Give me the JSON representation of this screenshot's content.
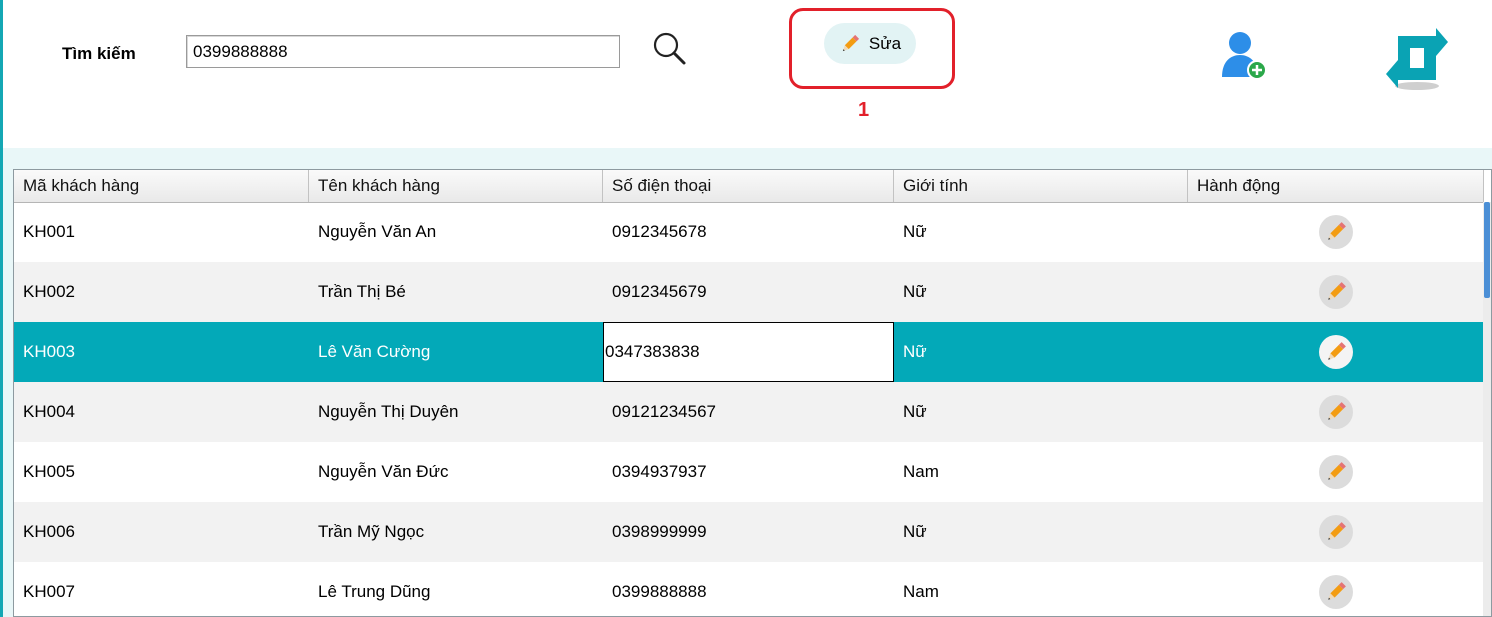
{
  "toolbar": {
    "search_label": "Tìm kiếm",
    "search_value": "0399888888",
    "search_icon": "search-icon",
    "edit_label": "Sửa",
    "edit_icon": "pencil-icon",
    "annotation_number": "1",
    "add_user_icon": "add-user-icon",
    "refresh_icon": "refresh-icon"
  },
  "table": {
    "columns": [
      "Mã khách hàng",
      "Tên khách hàng",
      "Số điện thoại",
      "Giới tính",
      "Hành động"
    ],
    "rows": [
      {
        "id": "KH001",
        "name": "Nguyễn Văn An",
        "phone": "0912345678",
        "gender": "Nữ",
        "action_icon": "pencil-icon"
      },
      {
        "id": "KH002",
        "name": "Trần Thị Bé",
        "phone": "0912345679",
        "gender": "Nữ",
        "action_icon": "pencil-icon"
      },
      {
        "id": "KH003",
        "name": "Lê Văn Cường",
        "phone": "0347383838",
        "gender": "Nữ",
        "action_icon": "pencil-icon",
        "selected": true,
        "editing_cell": "phone"
      },
      {
        "id": "KH004",
        "name": "Nguyễn Thị Duyên",
        "phone": "09121234567",
        "gender": "Nữ",
        "action_icon": "pencil-icon"
      },
      {
        "id": "KH005",
        "name": "Nguyễn Văn Đức",
        "phone": "0394937937",
        "gender": "Nam",
        "action_icon": "pencil-icon"
      },
      {
        "id": "KH006",
        "name": "Trần Mỹ Ngọc",
        "phone": "0398999999",
        "gender": "Nữ",
        "action_icon": "pencil-icon"
      },
      {
        "id": "KH007",
        "name": "Lê Trung Dũng",
        "phone": "0399888888",
        "gender": "Nam",
        "action_icon": "pencil-icon"
      }
    ]
  },
  "colors": {
    "accent": "#03a9b8",
    "highlight": "#e2202a",
    "pencil": "#f39c12",
    "add_user": "#2d8ee8",
    "refresh": "#0aa3b4"
  }
}
